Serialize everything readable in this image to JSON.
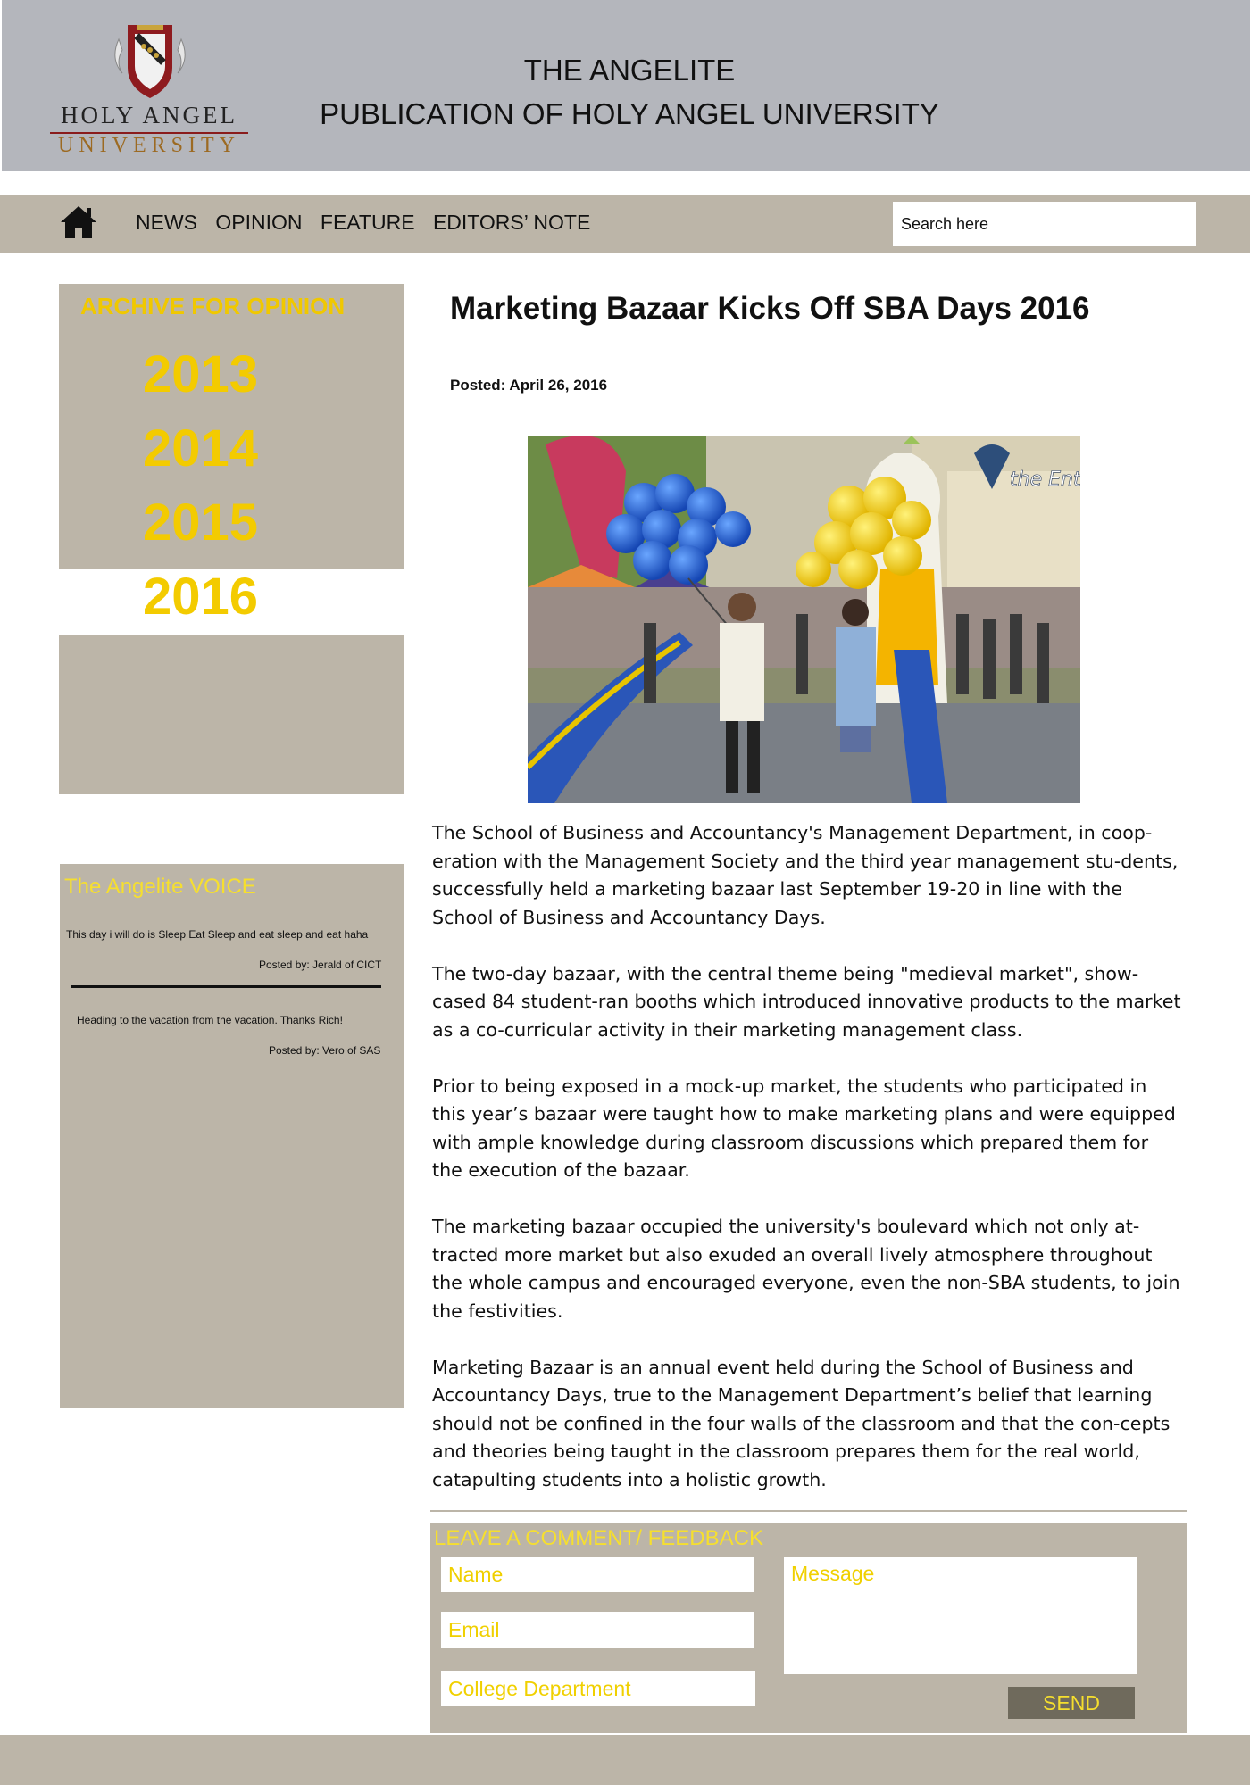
{
  "header": {
    "logo": {
      "line1": "HOLY ANGEL",
      "line2": "UNIVERSITY"
    },
    "title_line1": "THE ANGELITE",
    "title_line2": "PUBLICATION OF HOLY ANGEL UNIVERSITY"
  },
  "nav": {
    "home_icon": "home-icon",
    "items": [
      "NEWS",
      "OPINION",
      "FEATURE",
      "EDITORS’ NOTE"
    ],
    "search_placeholder": "Search here"
  },
  "archive": {
    "title": "ARCHIVE FOR OPINION",
    "years": [
      "2013",
      "2014",
      "2015",
      "2016"
    ]
  },
  "voice": {
    "title": "The Angelite VOICE",
    "posts": [
      {
        "text": "This day i will do is Sleep Eat Sleep and eat sleep and eat haha",
        "by": "Posted by: Jerald of CICT"
      },
      {
        "text": "Heading to the vacation from the vacation. Thanks Rich!",
        "by": "Posted by: Vero of SAS"
      }
    ]
  },
  "article": {
    "title": "Marketing Bazaar Kicks Off SBA Days 2016",
    "posted": "Posted: April 26, 2016",
    "photo_watermark": "the Enterprise",
    "paragraphs": [
      "The School of Business and Accountancy's Management Department, in coop-eration with the Management Society and the third year management stu-dents, successfully held a marketing bazaar last September 19-20 in line with the School of Business and Accountancy Days.",
      "The two-day bazaar, with the central theme being \"medieval market\", show-cased 84 student-ran booths which introduced innovative products to the market as a co-curricular activity in their marketing management class.",
      "Prior to being exposed in a mock-up market, the students who participated in this year’s bazaar were taught how to make marketing plans and were equipped with ample knowledge during classroom discussions which prepared them for the execution of the bazaar.",
      "The marketing bazaar occupied the university's boulevard which not only at-tracted more market but also exuded an overall lively atmosphere throughout the whole campus and encouraged everyone, even the non-SBA students, to join the festivities.",
      "Marketing Bazaar is an annual event held during the School of Business and Accountancy Days, true to the Management Department’s belief that learning should not be confined in the four walls of the classroom and that the con-cepts and theories being taught in the classroom prepares them for the real world, catapulting students into a holistic growth."
    ]
  },
  "comment": {
    "title": "LEAVE A COMMENT/ FEEDBACK",
    "name_placeholder": "Name",
    "email_placeholder": "Email",
    "department_placeholder": "College Department",
    "message_placeholder": "Message",
    "send_label": "SEND"
  },
  "colors": {
    "header_bg": "#b4b6bc",
    "panel_bg": "#bcb5a8",
    "accent_yellow": "#f3cb00",
    "send_bg": "#6f6a5c"
  }
}
